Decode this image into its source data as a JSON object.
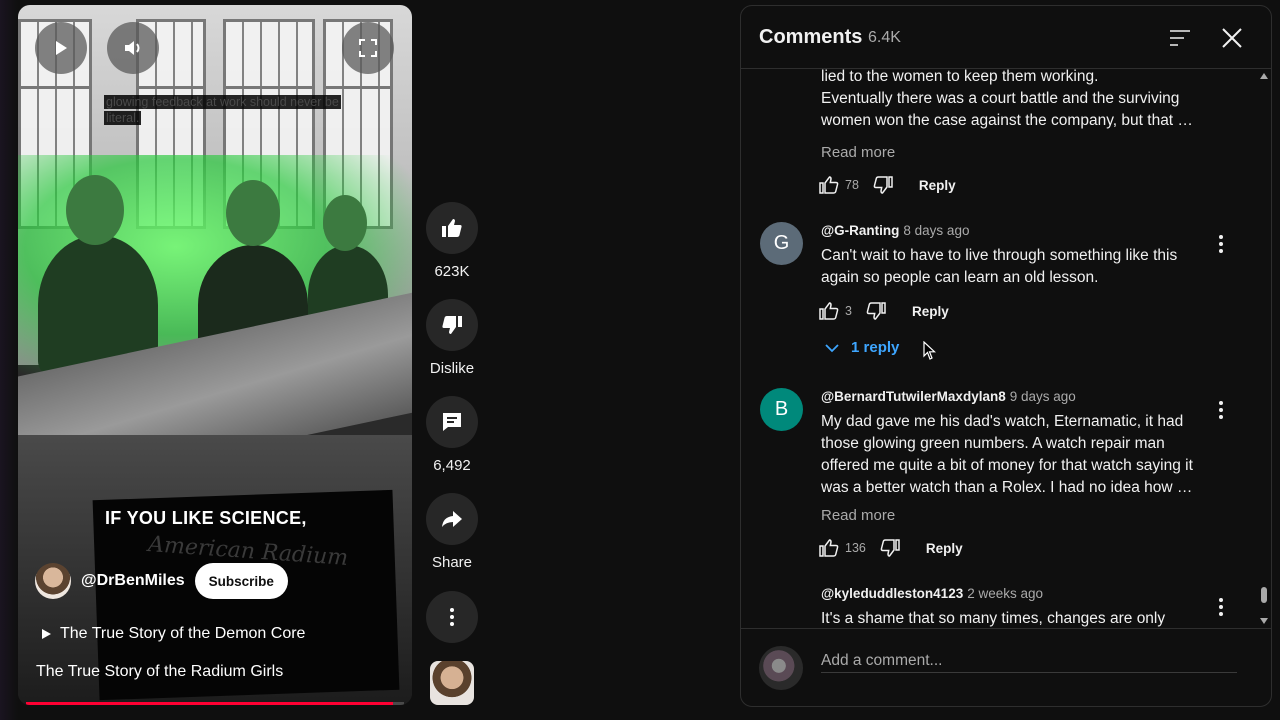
{
  "player": {
    "caption": "glowing feedback at work should never be literal.",
    "overlay_title": "IF YOU LIKE SCIENCE,",
    "chalkboard_text": "American Radium",
    "channel_name": "@DrBenMiles",
    "subscribe_label": "Subscribe",
    "playlist_item": "The True Story of the Demon Core",
    "video_title": "The True Story of the Radium Girls",
    "progress": 0.97,
    "icons": [
      "play-icon",
      "volume-icon",
      "fullscreen-icon"
    ]
  },
  "actions": {
    "like_count": "623K",
    "dislike_label": "Dislike",
    "comment_count": "6,492",
    "share_label": "Share"
  },
  "comments_panel": {
    "title": "Comments",
    "count": "6.4K",
    "composer_placeholder": "Add a comment...",
    "comments": [
      {
        "text_lines": [
          "lied to the women to keep them working.",
          "Eventually there was a court battle and the surviving",
          "women won the case against the company, but that …"
        ],
        "read_more": "Read more",
        "likes": "78",
        "reply_label": "Reply"
      },
      {
        "avatar_letter": "G",
        "avatar_color": "#5c6b78",
        "author": "@G-Ranting",
        "ago": "8 days ago",
        "text": "Can't wait to have to live through something like this again so people can learn an old lesson.",
        "likes": "3",
        "reply_label": "Reply",
        "replies_label": "1 reply"
      },
      {
        "avatar_letter": "B",
        "avatar_color": "#00897b",
        "author": "@BernardTutwilerMaxdylan8",
        "ago": "9 days ago",
        "text": "My dad gave me his dad's watch, Eternamatic, it had those glowing green numbers. A watch repair man offered me quite a bit of money for that watch saying it was a better watch than a Rolex. I had no idea how …",
        "read_more": "Read more",
        "likes": "136",
        "reply_label": "Reply"
      },
      {
        "author": "@kyleduddleston4123",
        "ago": "2 weeks ago",
        "text": "It's a shame that so many times, changes are only"
      }
    ]
  },
  "colors": {
    "background": "#0f0f0f",
    "link_blue": "#3ea6ff",
    "progress_red": "#ff0033"
  }
}
